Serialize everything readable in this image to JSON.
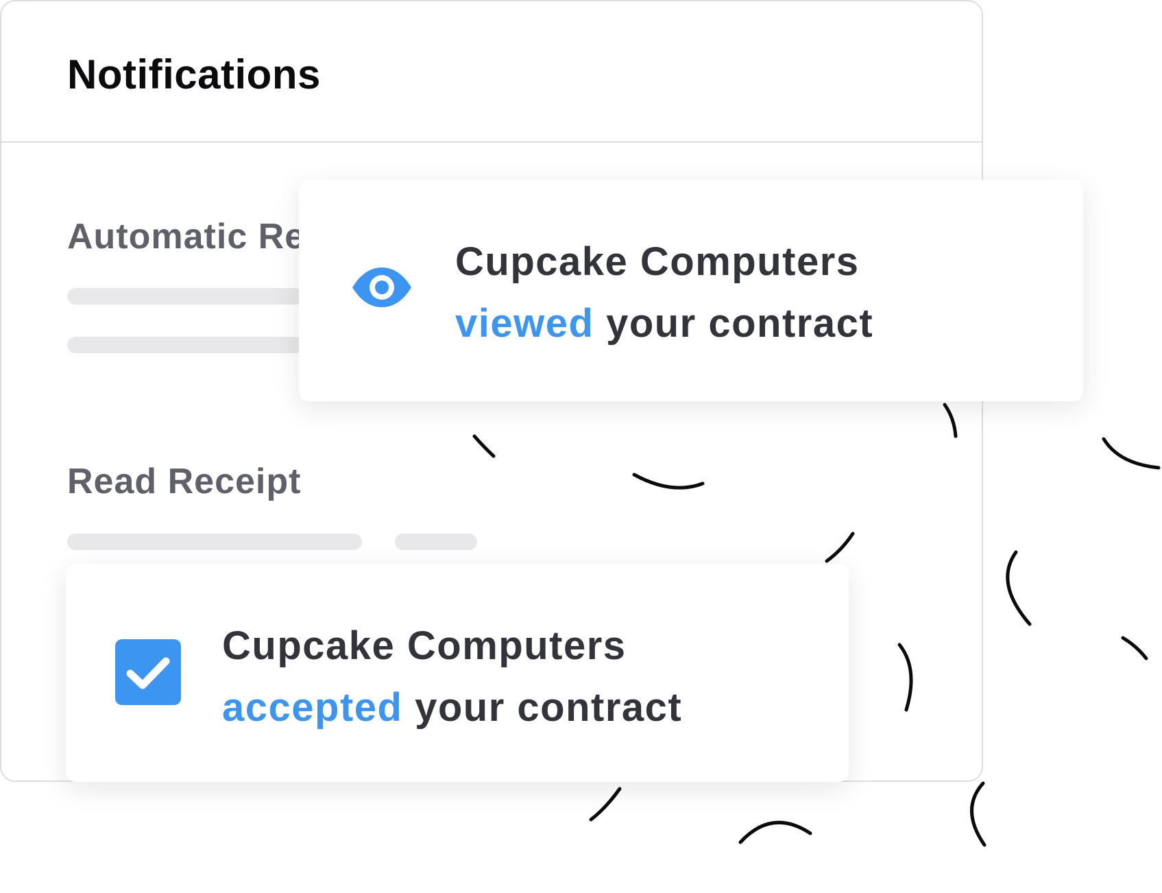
{
  "panel": {
    "title": "Notifications"
  },
  "sections": {
    "automatic_reminders": {
      "label": "Automatic Re"
    },
    "read_receipt": {
      "label": "Read Receipt"
    }
  },
  "notifications": {
    "viewed": {
      "company": "Cupcake Computers",
      "action": "viewed",
      "rest": "your contract",
      "icon": "eye-icon"
    },
    "accepted": {
      "company": "Cupcake Computers",
      "action": "accepted",
      "rest": "your contract",
      "icon": "checkbox-checked-icon"
    }
  },
  "colors": {
    "accent": "#3d95f2",
    "text": "#33343b",
    "title": "#0b0b0e",
    "label": "#5f6069",
    "skeleton": "#e8e8ea",
    "border": "#dcdde2"
  }
}
